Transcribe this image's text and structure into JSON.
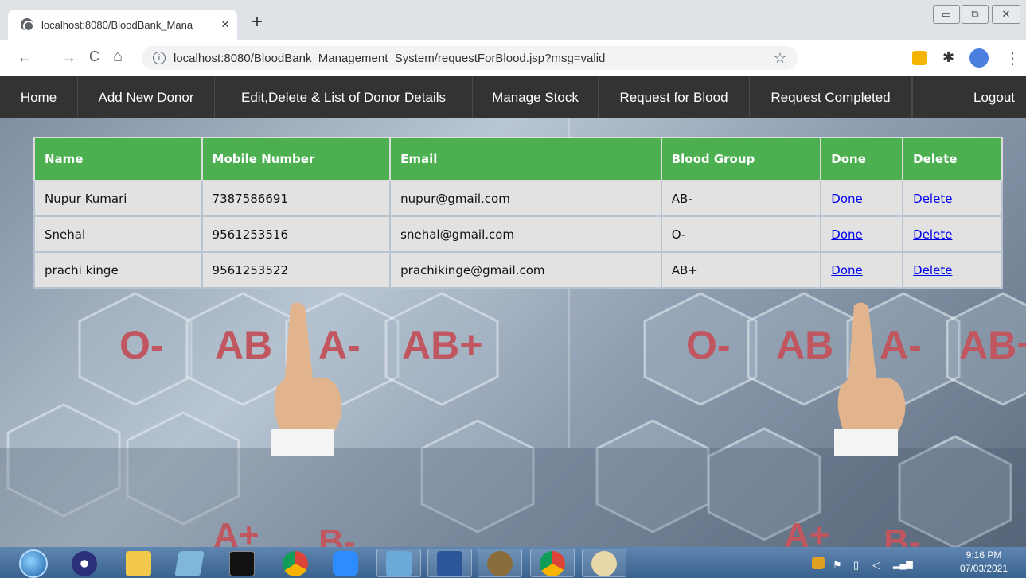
{
  "browser": {
    "tab_title": "localhost:8080/BloodBank_Mana",
    "tab_close": "×",
    "new_tab": "+",
    "url": "localhost:8080/BloodBank_Management_System/requestForBlood.jsp?msg=valid",
    "back": "←",
    "forward": "→",
    "reload": "C",
    "home": "⌂",
    "star": "☆",
    "menu": "⋮",
    "win_min": "▭",
    "win_max": "⧉",
    "win_close": "✕"
  },
  "nav": {
    "home": "Home",
    "add_donor": "Add New Donor",
    "edit_delete": "Edit,Delete & List of Donor Details",
    "manage_stock": "Manage Stock",
    "request_blood": "Request for Blood",
    "request_completed": "Request Completed",
    "logout": "Logout"
  },
  "table": {
    "headers": [
      "Name",
      "Mobile Number",
      "Email",
      "Blood Group",
      "Done",
      "Delete"
    ],
    "rows": [
      {
        "name": "Nupur Kumari",
        "mobile": "7387586691",
        "email": "nupur@gmail.com",
        "blood_group": "AB-",
        "done": "Done",
        "delete": "Delete"
      },
      {
        "name": "Snehal",
        "mobile": "9561253516",
        "email": "snehal@gmail.com",
        "blood_group": "O-",
        "done": "Done",
        "delete": "Delete"
      },
      {
        "name": "prachi kinge",
        "mobile": "9561253522",
        "email": "prachikinge@gmail.com",
        "blood_group": "AB+",
        "done": "Done",
        "delete": "Delete"
      }
    ]
  },
  "background": {
    "labels_left": [
      "O-",
      "AB",
      "A-",
      "AB+"
    ],
    "labels_right": [
      "O-",
      "AB",
      "A-",
      "AB+"
    ],
    "labels_bottom": [
      "A+",
      "B-",
      "A+",
      "B-"
    ]
  },
  "taskbar": {
    "time": "9:16 PM",
    "date": "07/03/2021"
  },
  "colors": {
    "nav_bg": "#333333",
    "header_green": "#4caf50",
    "link_blue": "#0000ee"
  }
}
